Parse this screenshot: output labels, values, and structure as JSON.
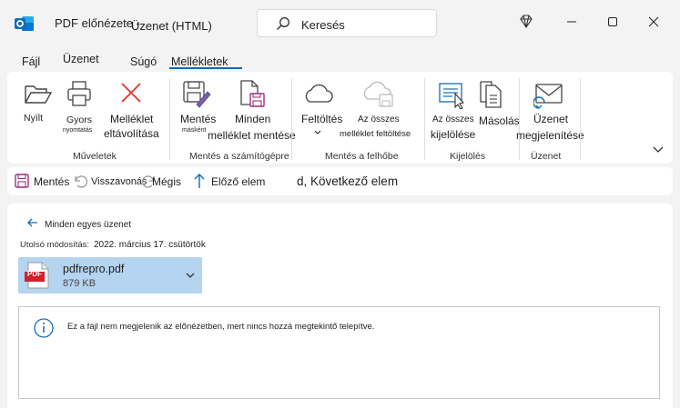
{
  "window": {
    "title_part1": "PDF előnézete -",
    "title_part2": "Üzenet (HTML)",
    "accent": "#0f6cbd"
  },
  "search": {
    "placeholder": "Keresés"
  },
  "menu_tabs": [
    "Fájl",
    "Üzenet",
    "Súgó",
    "Mellékletek"
  ],
  "ribbon": {
    "buttons": {
      "open": "Nyílt",
      "quick_print_1": "Gyors",
      "quick_print_2": "nyomtatás",
      "remove_1": "Melléklet",
      "remove_2": "eltávolítása",
      "save_as_1": "Mentés",
      "save_as_2": "másként",
      "save_all_1": "Minden",
      "save_all_2": "melléklet mentése",
      "upload": "Feltöltés",
      "upload_all_1": "Az összes",
      "upload_all_2": "melléklet feltöltése",
      "select_all_1": "Az összes",
      "select_all_2": "kijelölése",
      "copy": "Másolás",
      "show_msg_1": "Üzenet",
      "show_msg_2": "megjelenítése"
    },
    "groups": {
      "actions": "Műveletek",
      "save_to_pc": "Mentés a számítógépre",
      "save_to_cloud": "Mentés a felhőbe",
      "selection": "Kijelölés",
      "message": "Üzenet"
    }
  },
  "quick_access": {
    "save": "Mentés",
    "undo": "Visszavonás",
    "cancel": "Mégis",
    "prev": "Előző elem",
    "next": "d, Következő elem"
  },
  "content": {
    "back_link": "Minden egyes üzenet",
    "modified_label": "Utolsó módosítás:",
    "modified_value": "2022. március 17. csütörtök",
    "attachment": {
      "name": "pdfrepro.pdf",
      "size": "879 KB",
      "icon_text": "PDF"
    },
    "info_message": "Ez a fájl nem megjelenik az előnézetben, mert nincs hozzá megtekintő telepítve."
  }
}
